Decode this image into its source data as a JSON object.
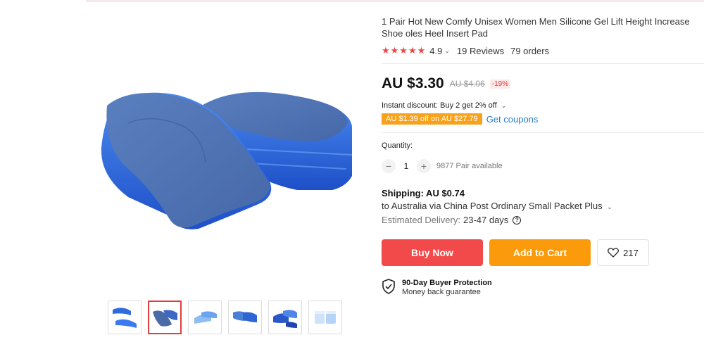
{
  "product": {
    "title": "1 Pair Hot New Comfy Unisex Women Men Silicone Gel Lift Height Increase Shoe oles Heel Insert Pad",
    "stars": "★★★★★",
    "rating": "4.9",
    "rating_chevron": "⌄",
    "reviews": "19 Reviews",
    "orders": "79 orders"
  },
  "price": {
    "current": "AU $3.30",
    "original": "AU $4.06",
    "discount": "-19%"
  },
  "promo": {
    "instant_discount": "Instant discount: Buy 2 get 2% off",
    "instant_chevron": "⌄",
    "coupon_tag": "AU $1.39 off on AU $27.79",
    "get_coupons": "Get coupons"
  },
  "quantity": {
    "label": "Quantity:",
    "minus": "−",
    "value": "1",
    "plus": "+",
    "available": "9877 Pair available"
  },
  "shipping": {
    "title": "Shipping: AU $0.74",
    "route": "to Australia via China Post Ordinary Small Packet Plus",
    "route_chevron": "⌄",
    "delivery_label": "Estimated Delivery:",
    "delivery_days": "23-47 days",
    "help_icon": "?"
  },
  "actions": {
    "buy_now": "Buy Now",
    "add_to_cart": "Add to Cart",
    "wishlist_count": "217"
  },
  "protection": {
    "title": "90-Day Buyer Protection",
    "subtitle": "Money back guarantee"
  },
  "colors": {
    "accent_red": "#f24a4a",
    "accent_orange": "#fb9a0b",
    "link_blue": "#2a7bc9",
    "insole_blue": "#3a6fc9"
  },
  "icons": [
    "heart-icon",
    "shield-check-icon",
    "question-icon"
  ],
  "gallery": {
    "thumbnail_count": 6,
    "active_index": 1
  }
}
